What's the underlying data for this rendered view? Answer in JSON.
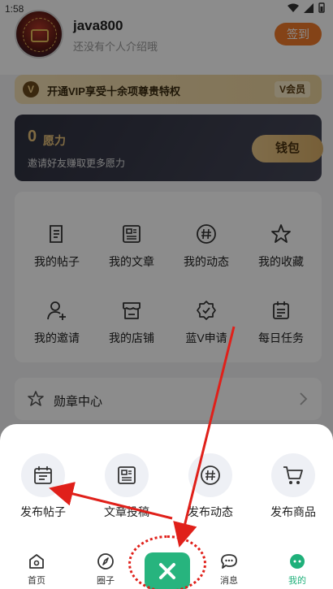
{
  "statusbar": {
    "time": "1:58"
  },
  "profile": {
    "username": "java800",
    "bio": "还没有个人介绍哦",
    "signin_label": "签到"
  },
  "vip": {
    "text": "开通VIP享受十余项尊贵特权",
    "icon_letter": "V",
    "badge": "V会员"
  },
  "wish": {
    "amount": "0",
    "amount_label": "愿力",
    "invite_text": "邀请好友赚取更多愿力",
    "wallet_label": "钱包"
  },
  "grid": {
    "items": [
      {
        "label": "我的帖子",
        "icon": "post-icon"
      },
      {
        "label": "我的文章",
        "icon": "article-icon"
      },
      {
        "label": "我的动态",
        "icon": "hashtag-icon"
      },
      {
        "label": "我的收藏",
        "icon": "star-icon"
      },
      {
        "label": "我的邀请",
        "icon": "user-add-icon"
      },
      {
        "label": "我的店铺",
        "icon": "shop-icon"
      },
      {
        "label": "蓝V申请",
        "icon": "verified-badge-icon"
      },
      {
        "label": "每日任务",
        "icon": "task-icon"
      }
    ]
  },
  "medal": {
    "label": "勋章中心"
  },
  "publish": {
    "items": [
      {
        "label": "发布帖子",
        "icon": "calendar-icon"
      },
      {
        "label": "文章投稿",
        "icon": "article-icon"
      },
      {
        "label": "发布动态",
        "icon": "hashtag-icon"
      },
      {
        "label": "发布商品",
        "icon": "cart-icon"
      }
    ]
  },
  "tabbar": {
    "items": [
      {
        "label": "首页",
        "icon": "home-icon"
      },
      {
        "label": "圈子",
        "icon": "compass-icon"
      },
      {
        "label": "消息",
        "icon": "chat-icon"
      },
      {
        "label": "我的",
        "icon": "profile-icon"
      }
    ],
    "active": "我的"
  },
  "colors": {
    "accent": "#27b47e",
    "signin": "#f07a2a",
    "annotation": "#e0201a",
    "gold": "#e9c37a"
  }
}
